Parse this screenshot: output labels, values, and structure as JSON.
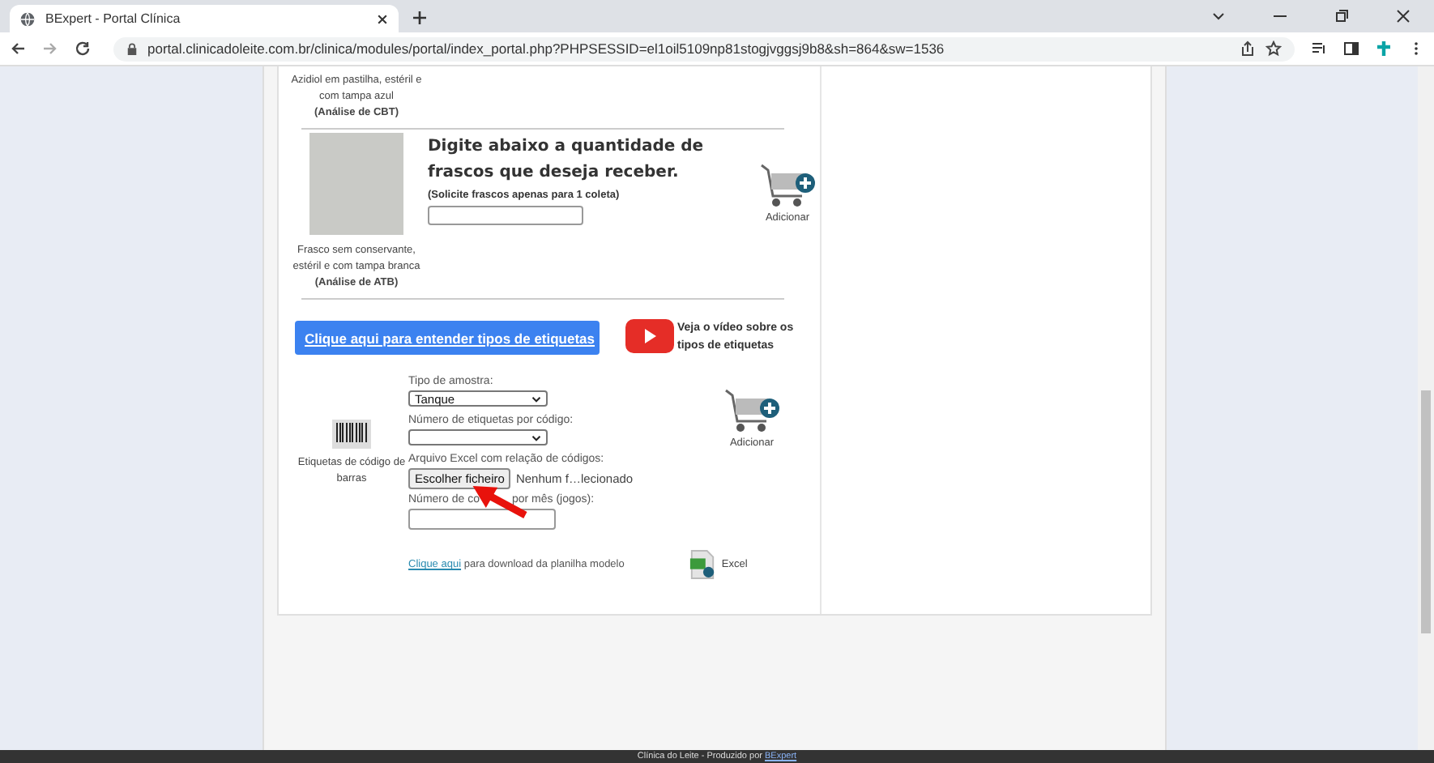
{
  "browser": {
    "tab_title": "BExpert - Portal Clínica",
    "url": "portal.clinicadoleite.com.br/clinica/modules/portal/index_portal.php?PHPSESSID=el1oil5109np81stogjvggsj9b8&sh=864&sw=1536"
  },
  "vials": [
    {
      "kind": "caption",
      "caption": "Azidiol em pastilha, estéril e com tampa azul **(Análise de CBT)**"
    },
    {
      "kind": "order",
      "caption": "Frasco sem conservante, estéril e com tampa branca **(Análise de ATB)**",
      "heading": "Digite abaixo a quantidade de frascos que deseja receber.",
      "note": "(Solicite frascos apenas para 1 coleta)",
      "add_label": "Adicionar"
    }
  ],
  "labels_button": "Clique aqui para entender tipos de etiquetas",
  "video_text": "Veja o vídeo sobre os tipos de etiquetas",
  "labels_form": {
    "caption": "Etiquetas de código de barras",
    "add_label": "Adicionar",
    "fields": [
      {
        "kind": "select",
        "label": "Tipo de amostra:",
        "value": "Tanque"
      },
      {
        "kind": "select",
        "label": "Número de etiquetas por código:"
      },
      {
        "kind": "file",
        "label": "Arquivo Excel com relação de códigos:",
        "button": "Escolher ficheiro",
        "status": "Nenhum f…lecionado"
      },
      {
        "kind": "text",
        "label_parts": [
          "Número de co",
          "por mês (jogos):"
        ]
      }
    ],
    "download_link": "Clique aqui",
    "download_text": "para download da planilha modelo",
    "excel_label": "Excel"
  },
  "footer": {
    "text": "Clínica do Leite - Produzido por",
    "link": "BExpert"
  }
}
